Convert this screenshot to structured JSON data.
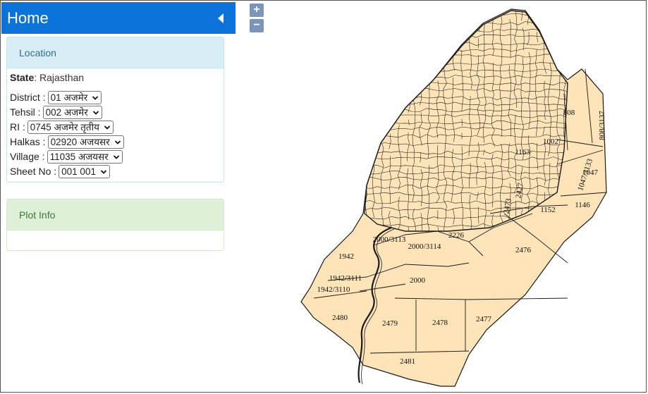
{
  "header": {
    "title": "Home"
  },
  "location_panel": {
    "heading": "Location",
    "state_label": "State",
    "state_value": ": Rajasthan",
    "fields": [
      {
        "label": "District :",
        "value": "01 अजमेर"
      },
      {
        "label": "Tehsil :",
        "value": "002 अजमेर"
      },
      {
        "label": "RI :",
        "value": "0745 अजमेर तृतीय"
      },
      {
        "label": "Halkas :",
        "value": "02920 अजयसर"
      },
      {
        "label": "Village :",
        "value": "11035 अजयसर"
      },
      {
        "label": "Sheet No :",
        "value": "001 001"
      }
    ]
  },
  "plot_info_panel": {
    "heading": "Plot Info"
  },
  "map": {
    "zoom_in": "+",
    "zoom_out": "−",
    "fill_color": "#fde3b8",
    "stroke_color": "#1a1a1a",
    "parcel_labels": [
      "808",
      "808/3137",
      "1002",
      "1047",
      "1146",
      "1047/3133",
      "1152",
      "1163",
      "2226",
      "2000/3113",
      "2000/3114",
      "1942",
      "1942/3111",
      "1942/3110",
      "2000",
      "2476",
      "2480",
      "2479",
      "2478",
      "2477",
      "2481",
      "2473",
      "2427"
    ]
  }
}
